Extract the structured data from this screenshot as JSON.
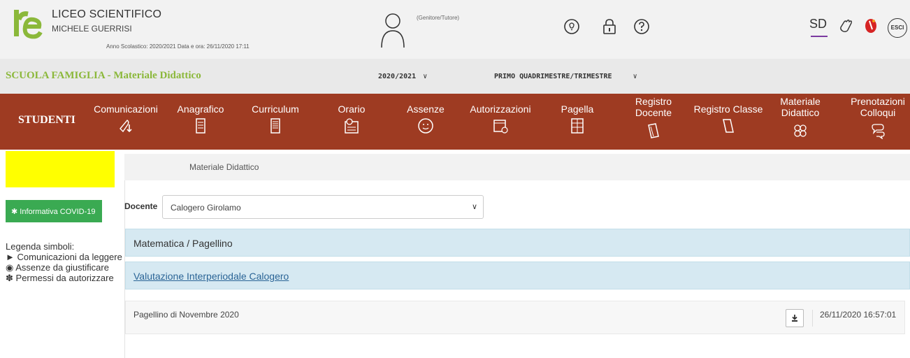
{
  "header": {
    "school_name": "LICEO SCIENTIFICO",
    "school_subtitle": "MICHELE GUERRISI",
    "year_info": "Anno Scolastico: 2020/2021   Data e ora: 26/11/2020 17:11",
    "role": "(Genitore/Tutore)",
    "icons": [
      "lightbulb-icon",
      "lock-icon",
      "help-icon",
      "sd-icon",
      "hand-icon",
      "flag-icon",
      "exit-icon"
    ],
    "logout_label": "ESCI",
    "sd_label": "SD"
  },
  "subbar": {
    "title": "SCUOLA FAMIGLIA - Materiale Didattico",
    "year": "2020/2021",
    "period": "PRIMO QUADRIMESTRE/TRIMESTRE",
    "arrow": "∨"
  },
  "nav": {
    "section": "STUDENTI",
    "items": [
      {
        "label": "Comunicazioni",
        "icon": "megaphone-icon"
      },
      {
        "label": "Anagrafico",
        "icon": "document-icon"
      },
      {
        "label": "Curriculum",
        "icon": "file-icon"
      },
      {
        "label": "Orario",
        "icon": "calendar-clock-icon"
      },
      {
        "label": "Assenze",
        "icon": "smiley-icon"
      },
      {
        "label": "Autorizzazioni",
        "icon": "calendar-check-icon"
      },
      {
        "label": "Pagella",
        "icon": "report-icon"
      },
      {
        "label": "Registro Docente",
        "icon": "book-icon"
      },
      {
        "label": "Registro Classe",
        "icon": "book-open-icon"
      },
      {
        "label": "Materiale Didattico",
        "icon": "puzzle-icon"
      },
      {
        "label": "Prenotazioni Colloqui",
        "icon": "chat-icon"
      }
    ]
  },
  "sidebar": {
    "covid_button": "Informativa COVID-19",
    "legend_title": "Legenda simboli:",
    "legend": [
      "Comunicazioni da leggere",
      "Assenze da giustificare",
      "Permessi da autorizzare"
    ]
  },
  "main": {
    "breadcrumb": "Materiale Didattico",
    "docente_label": "Docente",
    "docente_value": "Calogero Girolamo",
    "panels": [
      {
        "label": "Matematica / Pagellino"
      },
      {
        "label": "Valutazione Interperiodale Calogero"
      }
    ],
    "files": [
      {
        "title": "Pagellino di Novembre 2020",
        "timestamp": "26/11/2020 16:57:01"
      }
    ]
  },
  "colors": {
    "nav_bg": "#9e3b22",
    "title_green": "#8bb83a",
    "panel_blue": "#d6e9f2",
    "covid_green": "#3aaa52",
    "highlight_yellow": "#ffff00"
  }
}
